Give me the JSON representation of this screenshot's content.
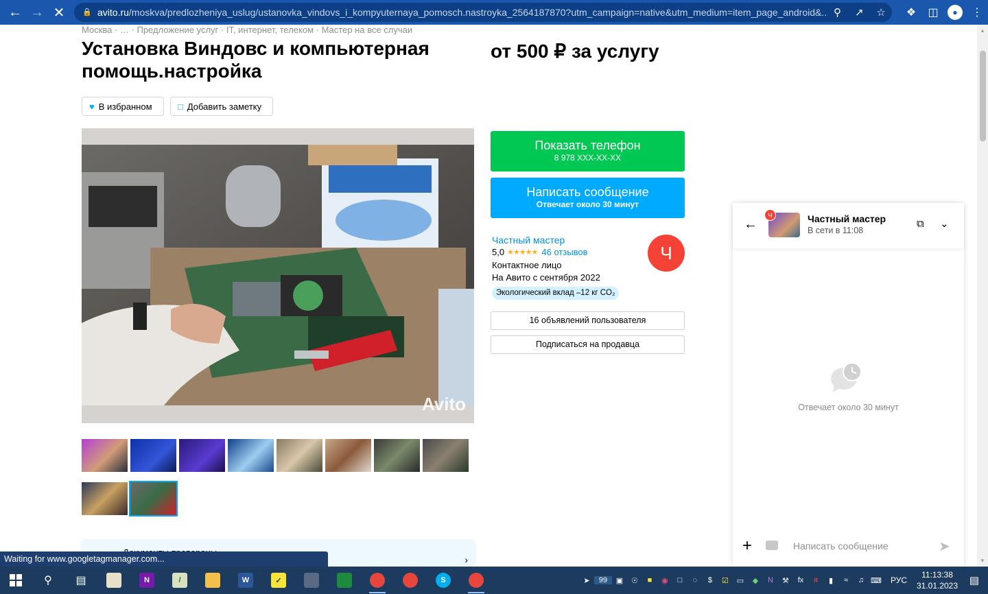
{
  "browser": {
    "url_host": "avito.ru",
    "url_rest": "/moskva/predlozheniya_uslug/ustanovka_vindovs_i_kompyuternaya_pomosch.nastroyka_2564187870?utm_campaign=native&utm_medium=item_page_android&..."
  },
  "breadcrumb": "Москва · … · Предложение услуг · IT, интернет, телеком · Мастер на все случаи",
  "listing": {
    "title": "Установка Виндовс и компьютерная помощь.настройка",
    "price": "от 500 ₽ за услугу",
    "favorite_label": "В избранном",
    "note_label": "Добавить заметку",
    "watermark": "Avito"
  },
  "contact": {
    "phone_label": "Показать телефон",
    "phone_number": "8 978 XXX-XX-XX",
    "message_label": "Написать сообщение",
    "message_sub": "Отвечает около 30 минут"
  },
  "seller": {
    "name": "Частный мастер",
    "rating": "5,0",
    "stars": "★★★★★",
    "reviews": "46 отзывов",
    "contact_person": "Контактное лицо",
    "since": "На Авито с сентября 2022",
    "eco": "Экологический вклад –12 кг CO₂",
    "avatar_letter": "Ч",
    "listings_button": "16 объявлений пользователя",
    "subscribe_button": "Подписаться на продавца"
  },
  "docs_text": "Документы проверены",
  "status_bar": "Waiting for www.googletagmanager.com...",
  "chat": {
    "name": "Частный мастер",
    "online": "В сети в 11:08",
    "badge": "Ч",
    "empty_text": "Отвечает около 30 минут",
    "input_placeholder": "Написать сообщение"
  },
  "taskbar": {
    "tray_badge": "99",
    "lang": "РУС",
    "time": "11:13:38",
    "date": "31.01.2023"
  },
  "colors": {
    "browser_bar": "#1a57ad",
    "green_button": "#00c853",
    "blue_button": "#00aaff",
    "link": "#0091e0",
    "seller_avatar": "#f44336"
  }
}
